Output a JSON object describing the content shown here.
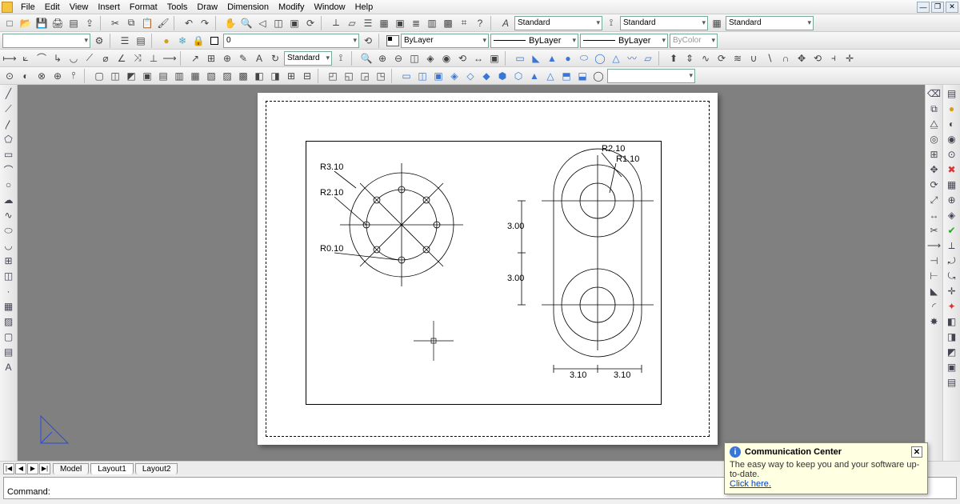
{
  "menu": [
    "File",
    "Edit",
    "View",
    "Insert",
    "Format",
    "Tools",
    "Draw",
    "Dimension",
    "Modify",
    "Window",
    "Help"
  ],
  "window_controls": {
    "min": "—",
    "restore": "❐",
    "close": "✕"
  },
  "row1": {
    "style_label": "Standard",
    "styles": [
      "Standard",
      "Standard",
      "Standard"
    ]
  },
  "row2": {
    "layer": "0",
    "color": "ByLayer",
    "linetype": "ByLayer",
    "lineweight": "ByLayer",
    "plotstyle": "ByColor"
  },
  "row3": {
    "dimstyle": "Standard"
  },
  "tabs": {
    "nav": [
      "|◀",
      "◀",
      "▶",
      "▶|"
    ],
    "items": [
      "Model",
      "Layout1",
      "Layout2"
    ],
    "active": 1
  },
  "command": {
    "prompt": "Command:"
  },
  "popup": {
    "title": "Communication Center",
    "body": "The easy way to keep you and your software up-to-date.",
    "link": "Click here."
  },
  "drawing": {
    "left_labels": [
      "R3.10",
      "R2.10",
      "R0.10"
    ],
    "right_labels": [
      "R2.10",
      "R1.10"
    ],
    "dims_v": [
      "3.00",
      "3.00"
    ],
    "dims_h": [
      "3.10",
      "3.10"
    ]
  },
  "icons": {
    "new": "□",
    "open": "📂",
    "save": "💾",
    "plot": "🖨",
    "cut": "✂",
    "copy": "⧉",
    "paste": "📋",
    "undo": "↶",
    "redo": "↷",
    "pan": "✋",
    "zoom": "🔍",
    "zoomwin": "◫",
    "orbit": "⟳",
    "props": "≣",
    "help": "?",
    "style": "A"
  }
}
